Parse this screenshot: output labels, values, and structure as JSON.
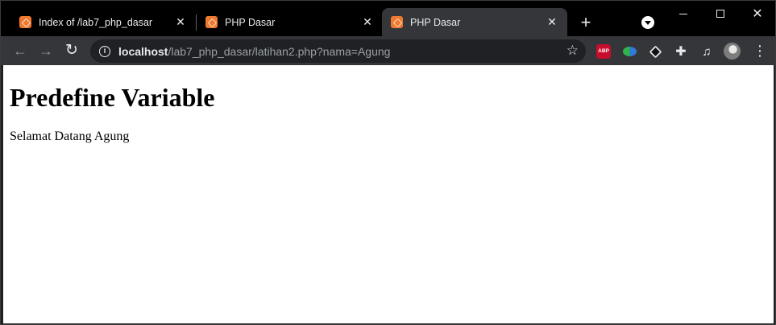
{
  "browser": {
    "tabs": [
      {
        "title": "Index of /lab7_php_dasar",
        "active": false
      },
      {
        "title": "PHP Dasar",
        "active": false
      },
      {
        "title": "PHP Dasar",
        "active": true
      }
    ],
    "close_glyph": "✕",
    "new_tab_glyph": "+",
    "url_host": "localhost",
    "url_path": "/lab7_php_dasar/latihan2.php?nama=Agung",
    "extensions": [
      {
        "name": "adblock-plus-icon",
        "label": "ABP",
        "color": "#c70d2c"
      },
      {
        "name": "idm-icon"
      },
      {
        "name": "cube-extension-icon"
      },
      {
        "name": "puzzle-extensions-icon"
      },
      {
        "name": "media-control-icon"
      }
    ],
    "colors": {
      "tabstrip": "#000000",
      "toolbar": "#35363a",
      "omnibox": "#202124",
      "favicon": "#ef7a2f"
    }
  },
  "page": {
    "heading": "Predefine Variable",
    "greeting": "Selamat Datang Agung"
  }
}
